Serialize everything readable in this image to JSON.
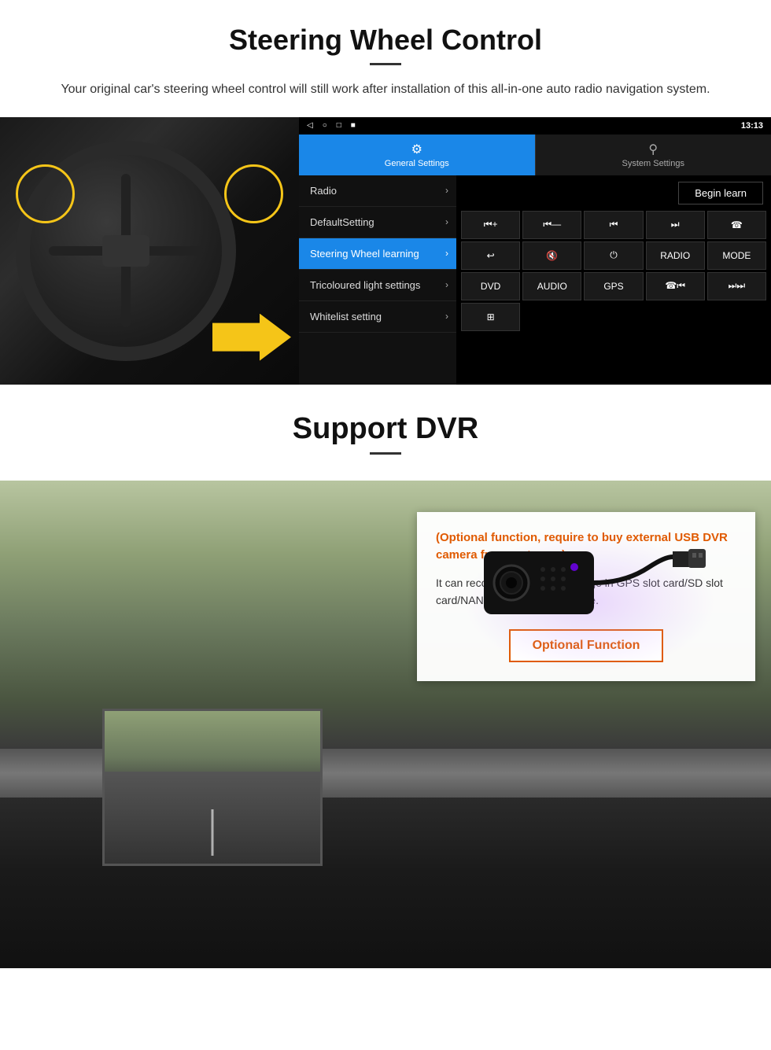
{
  "section1": {
    "title": "Steering Wheel Control",
    "description": "Your original car's steering wheel control will still work after installation of this all-in-one auto radio navigation system.",
    "statusbar": {
      "time": "13:13",
      "icons": [
        "◁",
        "○",
        "□",
        "■"
      ]
    },
    "tabs": {
      "general": "General Settings",
      "system": "System Settings"
    },
    "menu": {
      "items": [
        {
          "label": "Radio",
          "active": false
        },
        {
          "label": "DefaultSetting",
          "active": false
        },
        {
          "label": "Steering Wheel learning",
          "active": true
        },
        {
          "label": "Tricoloured light settings",
          "active": false
        },
        {
          "label": "Whitelist setting",
          "active": false
        }
      ]
    },
    "begin_learn": "Begin learn",
    "buttons": [
      "▐+",
      "▐—",
      "⏮",
      "⏭",
      "☎",
      "↩",
      "▐×",
      "⏻",
      "RADIO",
      "MODE",
      "DVD",
      "AUDIO",
      "GPS",
      "☎⏮",
      "⏭⏭"
    ]
  },
  "section2": {
    "title": "Support DVR",
    "divider": true,
    "optional_highlight": "(Optional function, require to buy external USB DVR camera from us to use)",
    "description": "It can record video only to storage in GPS slot card/SD slot card/NAND FLASH/USB storage.",
    "optional_button": "Optional Function"
  }
}
